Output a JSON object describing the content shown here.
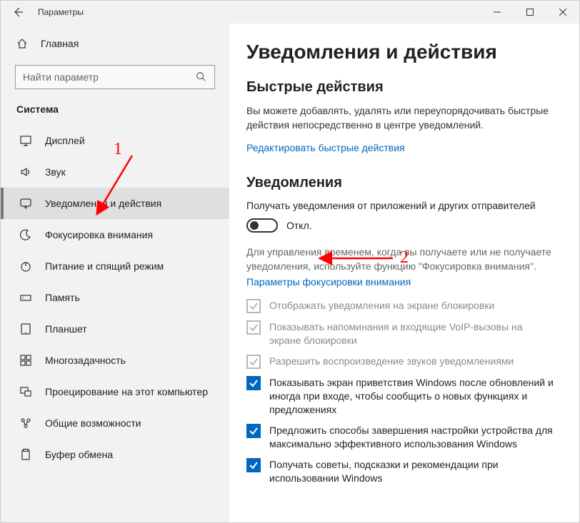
{
  "window": {
    "title": "Параметры"
  },
  "sidebar": {
    "home_label": "Главная",
    "search_placeholder": "Найти параметр",
    "category": "Система",
    "items": [
      {
        "label": "Дисплей"
      },
      {
        "label": "Звук"
      },
      {
        "label": "Уведомления и действия"
      },
      {
        "label": "Фокусировка внимания"
      },
      {
        "label": "Питание и спящий режим"
      },
      {
        "label": "Память"
      },
      {
        "label": "Планшет"
      },
      {
        "label": "Многозадачность"
      },
      {
        "label": "Проецирование на этот компьютер"
      },
      {
        "label": "Общие возможности"
      },
      {
        "label": "Буфер обмена"
      }
    ]
  },
  "main": {
    "heading": "Уведомления и действия",
    "quick_actions": {
      "heading": "Быстрые действия",
      "desc": "Вы можете добавлять, удалять или переупорядочивать быстрые действия непосредственно в центре уведомлений.",
      "link": "Редактировать быстрые действия"
    },
    "notifications": {
      "heading": "Уведомления",
      "toggle_label": "Получать уведомления от приложений и других отправителей",
      "toggle_state": "Откл.",
      "note": "Для управления временем, когда вы получаете или не получаете уведомления, используйте функцию \"Фокусировка внимания\".",
      "focus_link": "Параметры фокусировки внимания",
      "checks": [
        {
          "label": "Отображать уведомления на экране блокировки",
          "enabled": false,
          "checked": true
        },
        {
          "label": "Показывать напоминания и входящие VoIP-вызовы на экране блокировки",
          "enabled": false,
          "checked": true
        },
        {
          "label": "Разрешить  воспроизведение звуков уведомлениями",
          "enabled": false,
          "checked": true
        },
        {
          "label": "Показывать экран приветствия Windows после обновлений и иногда при входе, чтобы сообщить о новых функциях и предложениях",
          "enabled": true,
          "checked": true
        },
        {
          "label": "Предложить способы завершения настройки устройства для максимально эффективного использования Windows",
          "enabled": true,
          "checked": true
        },
        {
          "label": "Получать советы, подсказки и рекомендации при использовании Windows",
          "enabled": true,
          "checked": true
        }
      ]
    }
  },
  "annotations": {
    "one": "1",
    "two": "2"
  }
}
